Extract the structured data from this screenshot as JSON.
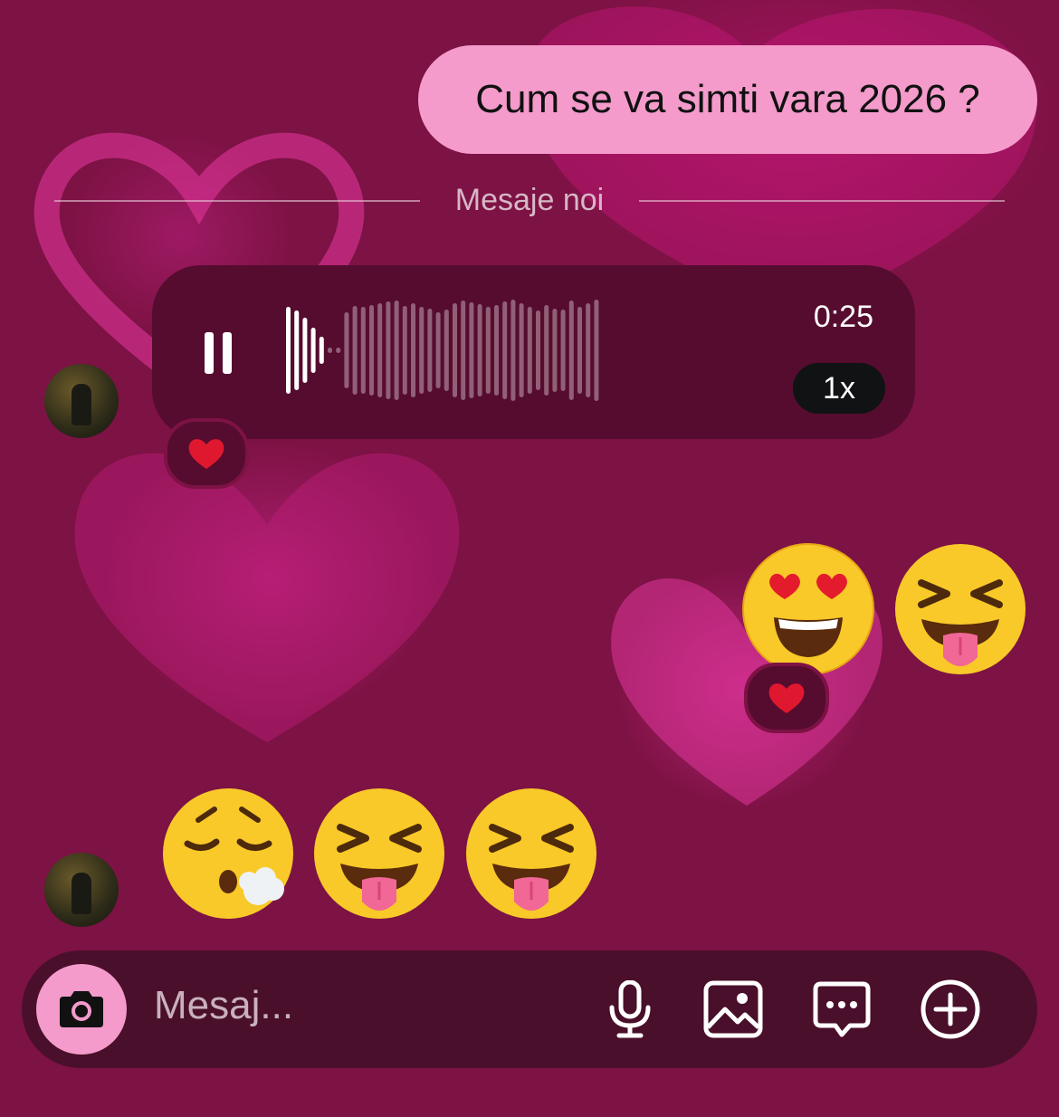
{
  "outgoing_message": {
    "text": "Cum se va simti vara 2026 ?"
  },
  "divider": {
    "label": "Mesaje noi"
  },
  "voice_message": {
    "duration": "0:25",
    "speed": "1x",
    "state": "playing",
    "progress": 0.09
  },
  "reactions": [
    {
      "emoji": "❤️",
      "target": "voice-message"
    },
    {
      "emoji": "❤️",
      "target": "heart-eyes-emoji"
    }
  ],
  "outgoing_emojis": [
    "smiling-face-with-heart-eyes",
    "squinting-face-with-tongue"
  ],
  "incoming_emojis": [
    "face-exhaling",
    "squinting-face-with-tongue",
    "squinting-face-with-tongue"
  ],
  "composer": {
    "placeholder": "Mesaj..."
  },
  "icons": [
    "camera-icon",
    "microphone-icon",
    "gallery-icon",
    "sticker-chat-icon",
    "plus-icon"
  ],
  "colors": {
    "background": "#7d1244",
    "outgoing_bubble": "#f49bcb",
    "voice_bubble": "#560c2f",
    "composer": "#4a0f2a"
  }
}
